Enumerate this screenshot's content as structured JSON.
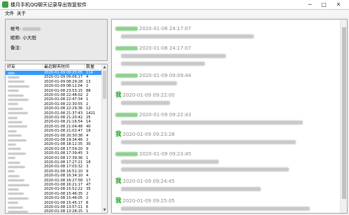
{
  "window": {
    "title": "楼月手机QQ聊天记录导出恢复软件",
    "minimize": "─",
    "maximize": "□",
    "close": "✕"
  },
  "menu": [
    "文件",
    "关于"
  ],
  "info": {
    "account_label": "帐号:",
    "nickname_label": "昵称:",
    "nickname_value": "小大阳",
    "note_label": "备注:"
  },
  "friends": {
    "columns": [
      "好友",
      "最近聊天时间",
      "数量"
    ],
    "rows": [
      {
        "time": "2020-01-09 09:25:05",
        "count": "114"
      },
      {
        "time": "2020-01-09 09:06:17",
        "count": "4"
      },
      {
        "time": "2020-01-09 08:29:28",
        "count": "13"
      },
      {
        "time": "2020-01-09 08:12:04",
        "count": "2"
      },
      {
        "time": "2020-01-08 23:53:15",
        "count": "88"
      },
      {
        "time": "2020-01-08 22:48:02",
        "count": "2"
      },
      {
        "time": "2020-01-08 22:47:34",
        "count": "1"
      },
      {
        "time": "2020-01-08 22:30:55",
        "count": "2"
      },
      {
        "time": "2020-01-08 22:29:36",
        "count": "12"
      },
      {
        "time": "2020-01-08 21:37:43",
        "count": "1421"
      },
      {
        "time": "2020-01-08 21:20:42",
        "count": "25"
      },
      {
        "time": "2020-01-08 21:16:54",
        "count": "14"
      },
      {
        "time": "2020-01-08 21:04:48",
        "count": "40"
      },
      {
        "time": "2020-01-08 21:02:47",
        "count": "18"
      },
      {
        "time": "2020-01-08 20:30:38",
        "count": "4"
      },
      {
        "time": "2020-01-08 19:34:46",
        "count": "2"
      },
      {
        "time": "2020-01-08 18:12:35",
        "count": "30"
      },
      {
        "time": "2020-01-08 17:59:20",
        "count": "9"
      },
      {
        "time": "2020-01-08 17:39:45",
        "count": "3"
      },
      {
        "time": "2020-01-08 17:39:36",
        "count": "1"
      },
      {
        "time": "2020-01-08 17:27:21",
        "count": "18"
      },
      {
        "time": "2020-01-08 17:03:32",
        "count": "3"
      },
      {
        "time": "2020-01-08 16:51:10",
        "count": "9"
      },
      {
        "time": "2020-01-08 16:34:10",
        "count": "4"
      },
      {
        "time": "2020-01-08 16:27:58",
        "count": "17"
      },
      {
        "time": "2020-01-08 16:21:17",
        "count": "47"
      },
      {
        "time": "2020-01-08 15:52:22",
        "count": "35"
      },
      {
        "time": "2020-01-08 15:46:35",
        "count": "2"
      },
      {
        "time": "2020-01-08 15:46:05",
        "count": "2"
      },
      {
        "time": "2020-01-08 15:45:17",
        "count": "8"
      },
      {
        "time": "2020-01-08 13:57:21",
        "count": "6"
      },
      {
        "time": "2020-01-08 13:28:15",
        "count": "1"
      }
    ]
  },
  "chat": {
    "me_label": "我",
    "messages": [
      {
        "who": "contact",
        "time": "2020-01-08 24:17:07"
      },
      {
        "who": "contact",
        "time": "2020-01-08 24:17:07"
      },
      {
        "who": "contact",
        "time": "2020-01-09 09:09:44"
      },
      {
        "who": "me",
        "time": "2020-01-09 09:22:00"
      },
      {
        "who": "contact",
        "time": "2020-01-09 09:22:43"
      },
      {
        "who": "me",
        "time": "2020-01-09 09:23:28"
      },
      {
        "who": "contact",
        "time": "2020-01-09 09:23:45"
      },
      {
        "who": "me",
        "time": "2020-01-09 09:24:45"
      },
      {
        "who": "me",
        "time": "2020-01-09 09:25:05"
      }
    ]
  },
  "colors": {
    "selection": "#3399ff",
    "me_sender": "#1a9e1a",
    "timestamp": "#8a8a8a"
  },
  "icons": [
    "app-icon",
    "scroll-up-icon",
    "scroll-down-icon"
  ]
}
